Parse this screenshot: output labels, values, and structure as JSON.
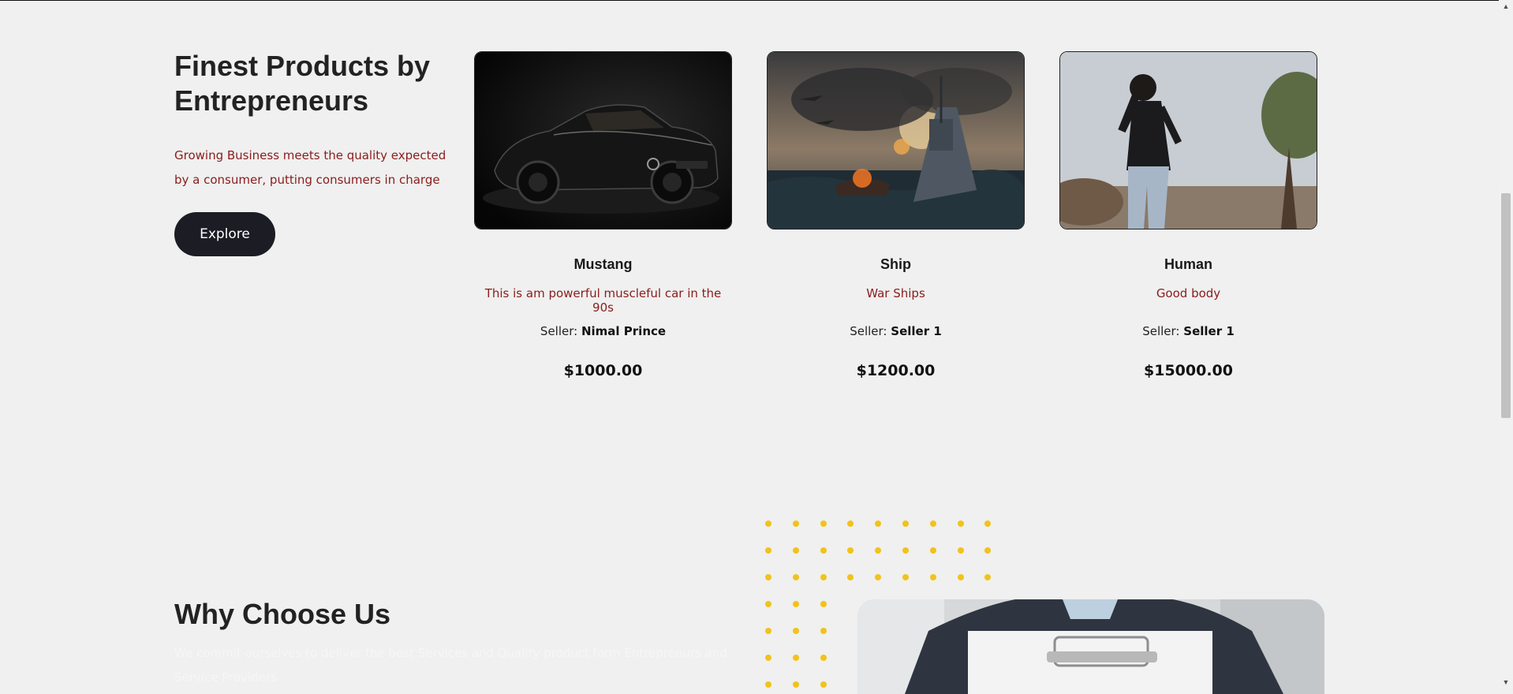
{
  "intro": {
    "title": "Finest Products by Entrepreneurs",
    "description": "Growing Business meets the quality expected by a consumer, putting consumers in charge",
    "explore_label": "Explore"
  },
  "products": [
    {
      "name": "Mustang",
      "description": "This is am powerful muscleful car in the 90s",
      "seller_label": "Seller:",
      "seller": "Nimal Prince",
      "price": "$1000.00"
    },
    {
      "name": "Ship",
      "description": "War Ships",
      "seller_label": "Seller:",
      "seller": "Seller 1",
      "price": "$1200.00"
    },
    {
      "name": "Human",
      "description": "Good body",
      "seller_label": "Seller:",
      "seller": "Seller 1",
      "price": "$15000.00"
    }
  ],
  "why": {
    "title": "Why Choose Us",
    "text": "We commit ourselves to deliver the best Services and Quality product form Entreprenurs and Service Providers"
  },
  "colors": {
    "background": "#eff0ef",
    "accent_red": "#8a1c1c",
    "button_dark": "#1b1c24",
    "dot_yellow": "#f2c21b"
  },
  "icons": {
    "scroll_up": "▲",
    "scroll_down": "▼"
  }
}
